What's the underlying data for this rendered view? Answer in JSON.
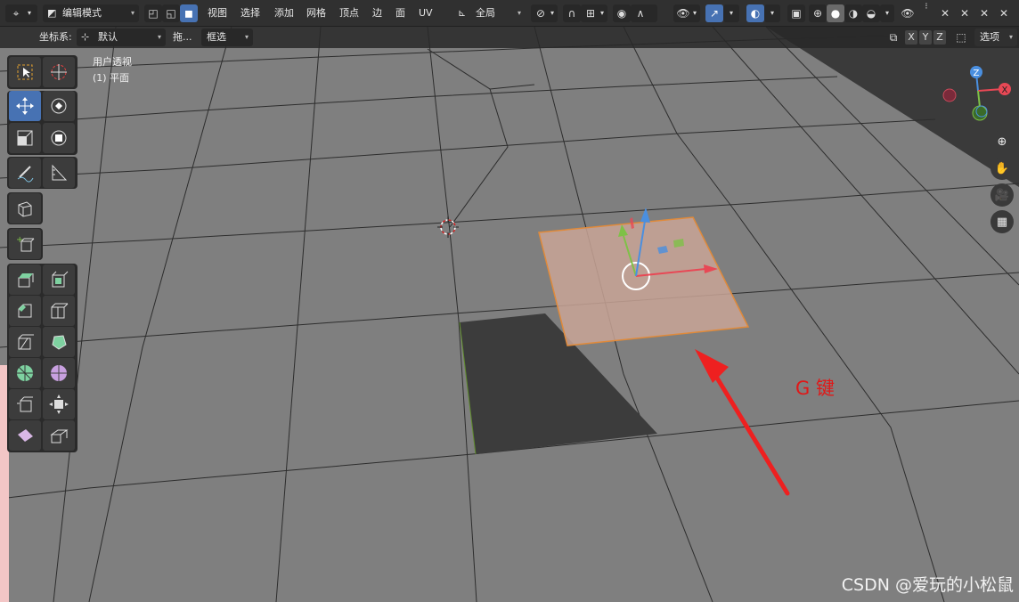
{
  "header": {
    "mode_dropdown": "编辑模式",
    "menus": [
      "视图",
      "选择",
      "添加",
      "网格",
      "顶点",
      "边",
      "面",
      "UV"
    ],
    "transform_orientation": "全局"
  },
  "subheader": {
    "coord_label": "坐标系:",
    "coord_value": "默认",
    "drag_label": "拖...",
    "drag_value": "框选",
    "axes": [
      "X",
      "Y",
      "Z"
    ],
    "options_label": "选项"
  },
  "viewport": {
    "view_name": "用户透视",
    "object_name": "(1) 平面"
  },
  "annotation": {
    "label": "G 键",
    "color": "#e01818"
  },
  "watermark": "CSDN @爱玩的小松鼠",
  "colors": {
    "selected_face": "#c9a596",
    "selected_edge": "#e08a3a",
    "dark_hole": "#3c3c3c",
    "active_tool": "#4772b3",
    "gizmo_x": "#e84855",
    "gizmo_y": "#7ec147",
    "gizmo_z": "#4a8fe0"
  },
  "toolbar": {
    "tools": [
      "select-box",
      "cursor",
      "move",
      "rotate",
      "scale",
      "transform",
      "annotate",
      "measure",
      "add-cube",
      "add-cube-2",
      "extrude",
      "inset",
      "bevel",
      "loop-cut",
      "knife",
      "poly-build",
      "spin",
      "smooth",
      "edge-slide",
      "shrink-fatten",
      "shear",
      "rip"
    ]
  },
  "nav_gizmo": {
    "axes": [
      "X",
      "Y",
      "Z"
    ]
  }
}
